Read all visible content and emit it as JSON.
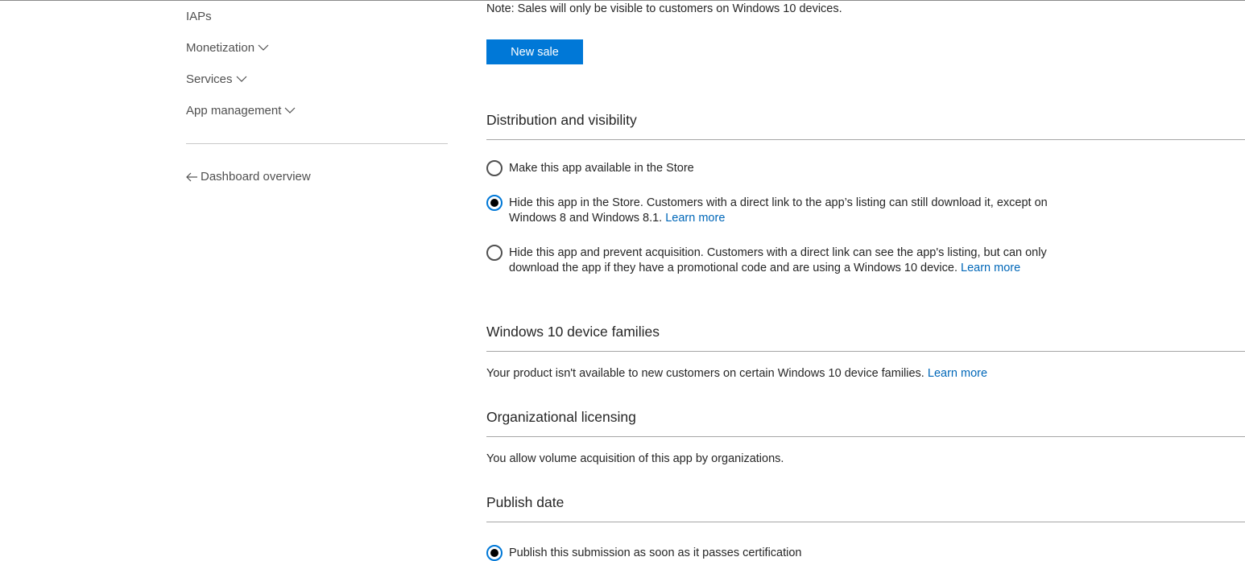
{
  "sidebar": {
    "items": [
      {
        "label": "IAPs",
        "has_chevron": false
      },
      {
        "label": "Monetization",
        "has_chevron": true
      },
      {
        "label": "Services",
        "has_chevron": true
      },
      {
        "label": "App management",
        "has_chevron": true
      }
    ],
    "back_link": {
      "label": "Dashboard overview",
      "icon": "arrow-left-icon"
    }
  },
  "main": {
    "note": "Note: Sales will only be visible to customers on Windows 10 devices.",
    "new_sale_button": "New sale",
    "distribution": {
      "title": "Distribution and visibility",
      "options": [
        {
          "text": "Make this app available in the Store",
          "link": "",
          "checked": false
        },
        {
          "text": "Hide this app in the Store. Customers with a direct link to the app’s listing can still download it, except on Windows 8 and Windows 8.1.",
          "link": "Learn more",
          "checked": true
        },
        {
          "text": "Hide this app and prevent acquisition. Customers with a direct link can see the app's listing, but can only download the app if they have a promotional code and are using a Windows 10 device.",
          "link": "Learn more",
          "checked": false
        }
      ]
    },
    "device_families": {
      "title": "Windows 10 device families",
      "text": "Your product isn't available to new customers on certain Windows 10 device families.",
      "link": "Learn more"
    },
    "org_licensing": {
      "title": "Organizational licensing",
      "text": "You allow volume acquisition of this app by organizations."
    },
    "publish_date": {
      "title": "Publish date",
      "option": {
        "text": "Publish this submission as soon as it passes certification",
        "checked": true
      }
    }
  },
  "colors": {
    "accent": "#0078d7",
    "link": "#0067b8",
    "text": "#262626",
    "nav_text": "#505050"
  }
}
